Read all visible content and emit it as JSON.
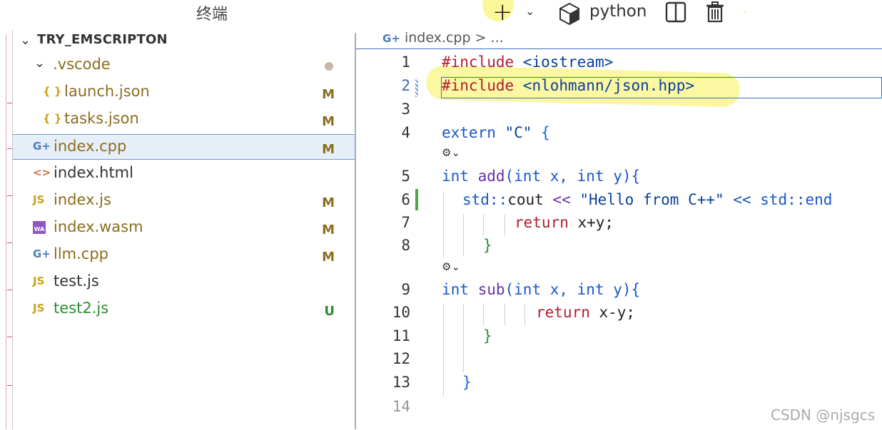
{
  "top_bar": {
    "terminal_title": "终端",
    "plus_icon": "plus-icon",
    "chevron": "⌄",
    "profile_label": "python"
  },
  "explorer": {
    "root_label": "TRY_EMSCRIPTON",
    "items": [
      {
        "label": ".vscode",
        "badge": "",
        "icon": "",
        "color": "#8a6d1e"
      },
      {
        "label": "launch.json",
        "badge": "M",
        "icon": "{ }",
        "color": "#8a6d1e"
      },
      {
        "label": "tasks.json",
        "badge": "M",
        "icon": "{ }",
        "color": "#8a6d1e"
      },
      {
        "label": "index.cpp",
        "badge": "M",
        "icon": "G+",
        "color": "#8a6d1e"
      },
      {
        "label": "index.html",
        "badge": "",
        "icon": "<>",
        "color": "#333333"
      },
      {
        "label": "index.js",
        "badge": "M",
        "icon": "JS",
        "color": "#8a6d1e"
      },
      {
        "label": "index.wasm",
        "badge": "M",
        "icon": "WA",
        "color": "#8a6d1e"
      },
      {
        "label": "llm.cpp",
        "badge": "M",
        "icon": "G+",
        "color": "#8a6d1e"
      },
      {
        "label": "test.js",
        "badge": "",
        "icon": "JS",
        "color": "#333333"
      },
      {
        "label": "test2.js",
        "badge": "U",
        "icon": "JS",
        "color": "#2e8b2e"
      }
    ]
  },
  "editor": {
    "breadcrumb_file": "index.cpp",
    "breadcrumb_rest": "> ...",
    "line_numbers": [
      "1",
      "2",
      "3",
      "4",
      "5",
      "6",
      "7",
      "8",
      "9",
      "10",
      "11",
      "12",
      "13",
      "14"
    ],
    "lines": {
      "l1_kw": "#include",
      "l1_rest": " <iostream>",
      "l2_kw": "#include",
      "l2_rest": " <nlohmann/json.hpp>",
      "l4_a": "extern ",
      "l4_b": "\"C\"",
      "l4_c": " {",
      "l5_type": "int",
      "l5_fn": " add",
      "l5_rest": "(int x, int y){",
      "l6_a": "std::",
      "l6_b": "cout",
      "l6_c": " << ",
      "l6_d": "\"Hello from C++\"",
      "l6_e": " << std::end",
      "l7_kw": "return",
      "l7_rest": " x+y;",
      "l8": "}",
      "l9_type": "int",
      "l9_fn": " sub",
      "l9_rest": "(int x, int y){",
      "l10_kw": "return",
      "l10_rest": " x-y;",
      "l11": "}",
      "l13": "}"
    },
    "lens_glyph": "⚙⌄"
  },
  "watermark": "CSDN @njsgcs"
}
